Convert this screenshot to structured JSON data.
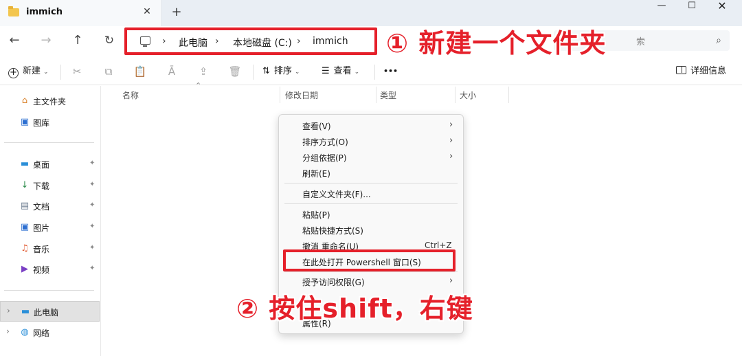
{
  "window": {
    "tab_title": "immich",
    "tab_close": "✕",
    "new_tab": "+",
    "minimize": "—",
    "maximize": "☐",
    "close": "✕"
  },
  "nav": {
    "back": "←",
    "forward": "→",
    "up": "↑",
    "refresh": "↻",
    "breadcrumb": [
      "此电脑",
      "本地磁盘 (C:)",
      "immich"
    ],
    "separator": "›",
    "search_visible_text": "索",
    "search_icon": "search-icon"
  },
  "toolbar": {
    "new_label": "新建",
    "sort_label": "排序",
    "view_label": "查看",
    "more_label": "•••",
    "details_label": "详细信息",
    "icons": [
      "cut-icon",
      "copy-icon",
      "paste-icon",
      "rename-icon",
      "share-icon",
      "delete-icon"
    ]
  },
  "sidebar": {
    "items": [
      {
        "label": "主文件夹",
        "icon": "home-icon"
      },
      {
        "label": "图库",
        "icon": "gallery-icon"
      },
      {
        "label": "桌面",
        "icon": "desktop-icon",
        "pinned": true
      },
      {
        "label": "下载",
        "icon": "download-icon",
        "pinned": true
      },
      {
        "label": "文档",
        "icon": "documents-icon",
        "pinned": true
      },
      {
        "label": "图片",
        "icon": "pictures-icon",
        "pinned": true
      },
      {
        "label": "音乐",
        "icon": "music-icon",
        "pinned": true
      },
      {
        "label": "视频",
        "icon": "videos-icon",
        "pinned": true
      },
      {
        "label": "此电脑",
        "icon": "this-pc-icon",
        "selected": true,
        "expandable": true
      },
      {
        "label": "网络",
        "icon": "network-icon",
        "expandable": true
      }
    ],
    "pin_glyph": "📌",
    "expander_glyph": "›"
  },
  "columns": [
    "名称",
    "修改日期",
    "类型",
    "大小"
  ],
  "context_menu": {
    "items": [
      {
        "label": "查看(V)",
        "submenu": true
      },
      {
        "label": "排序方式(O)",
        "submenu": true
      },
      {
        "label": "分组依据(P)",
        "submenu": true
      },
      {
        "label": "刷新(E)"
      },
      {
        "label": "自定义文件夹(F)..."
      },
      {
        "label": "粘贴(P)"
      },
      {
        "label": "粘贴快捷方式(S)"
      },
      {
        "label": "撤消 重命名(U)",
        "shortcut": "Ctrl+Z"
      },
      {
        "label": "在此处打开 Powershell 窗口(S)",
        "highlighted": true
      },
      {
        "label": "授予访问权限(G)",
        "submenu": true
      },
      {
        "label": "属性(R)"
      }
    ],
    "submenu_arrow": "›"
  },
  "annotations": {
    "step1": "① 新建一个文件夹",
    "step2": "② 按住shift，右键",
    "accent_color": "#e5202a"
  }
}
